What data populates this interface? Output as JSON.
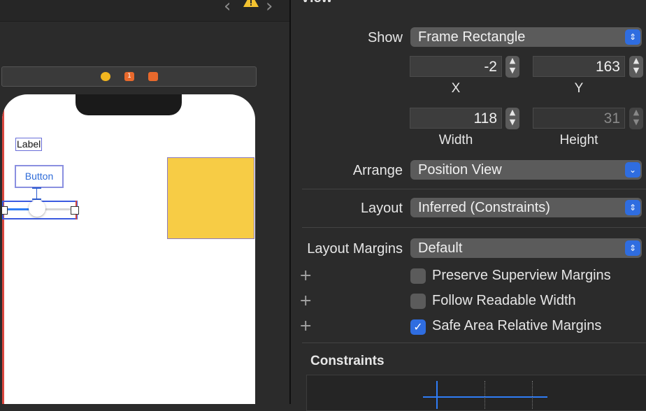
{
  "canvas": {
    "nav_back": "‹",
    "nav_forward": "›",
    "scene_first_badge": "1",
    "label_text": "Label",
    "button_text": "Button",
    "colors": {
      "yellow_view": "#f7cc45",
      "selection": "#3b5be0",
      "slider_fill": "#2f7df6"
    }
  },
  "inspector": {
    "section_title": "View",
    "show": {
      "label": "Show",
      "value": "Frame Rectangle"
    },
    "frame": {
      "x": "-2",
      "y": "163",
      "width": "118",
      "height": "31",
      "x_caption": "X",
      "y_caption": "Y",
      "width_caption": "Width",
      "height_caption": "Height"
    },
    "arrange": {
      "label": "Arrange",
      "value": "Position View"
    },
    "layout": {
      "label": "Layout",
      "value": "Inferred (Constraints)"
    },
    "layout_margins": {
      "label": "Layout Margins",
      "value": "Default"
    },
    "checkboxes": [
      {
        "label": "Preserve Superview Margins",
        "checked": false
      },
      {
        "label": "Follow Readable Width",
        "checked": false
      },
      {
        "label": "Safe Area Relative Margins",
        "checked": true
      }
    ],
    "plus_glyph": "+",
    "constraints_title": "Constraints",
    "accent_color": "#2f6de0"
  }
}
